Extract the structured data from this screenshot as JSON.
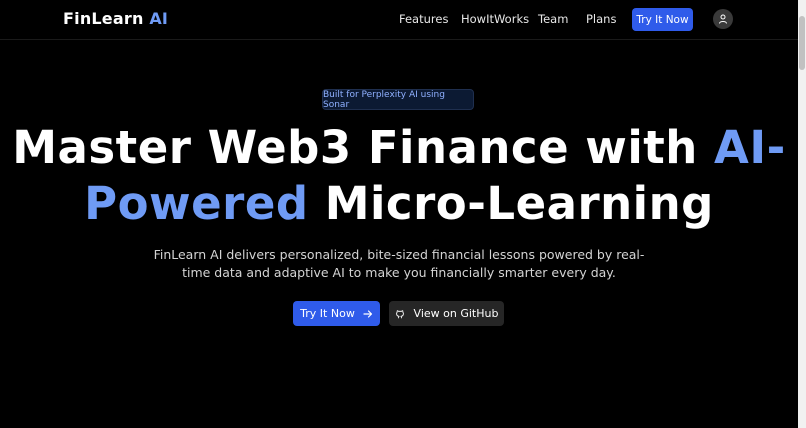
{
  "nav": {
    "logo_main": "FinLearn",
    "logo_accent": "AI",
    "links": [
      "Features",
      "HowItWorks",
      "Team",
      "Plans"
    ],
    "cta": "Try It Now",
    "avatar_icon": "user-icon"
  },
  "hero": {
    "badge": "Built for Perplexity AI using Sonar",
    "headline_part1": "Master Web3 Finance with ",
    "headline_accent1": "AI-",
    "headline_accent2": "Powered",
    "headline_part2": " Micro-Learning",
    "subtitle": "FinLearn AI delivers personalized, bite-sized financial lessons powered by real-time data and adaptive AI to make you financially smarter every day.",
    "primary_button": "Try It Now",
    "primary_icon": "arrow-right-icon",
    "secondary_button": "View on GitHub",
    "secondary_icon": "github-icon"
  },
  "colors": {
    "background": "#000000",
    "accent": "#6f9bf5",
    "button_blue": "#2f5bea",
    "button_dark": "#262626"
  }
}
